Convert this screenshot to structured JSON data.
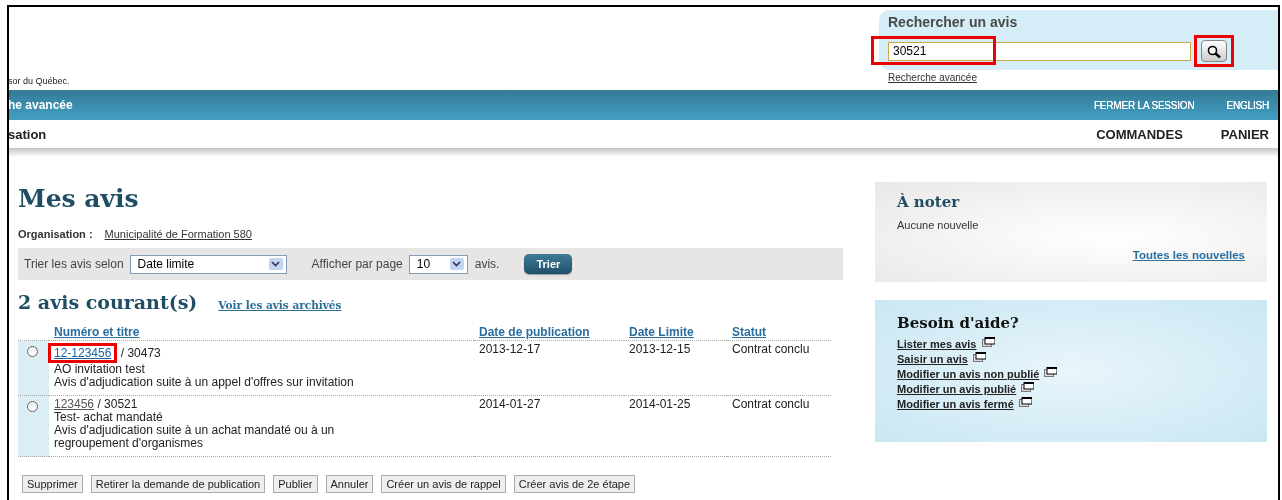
{
  "header": {
    "tagline": "sor du Québec.",
    "search": {
      "title": "Rechercher un avis",
      "value": "30521",
      "highlighted": true,
      "button_highlighted": true,
      "advanced_link": "Recherche avancée"
    },
    "top_bar": {
      "left": "he avancée",
      "links": [
        "FERMER LA SESSION",
        "ENGLISH"
      ]
    },
    "nav": {
      "left": "sation",
      "items": [
        "COMMANDES",
        "PANIER"
      ]
    }
  },
  "main": {
    "title": "Mes avis",
    "organisation_label": "Organisation :",
    "organisation": "Municipalité de Formation 580",
    "sort": {
      "label": "Trier les avis selon",
      "value": "Date limite",
      "per_page_label": "Afficher par page",
      "per_page": "10",
      "per_page_suffix": "avis.",
      "button": "Trier"
    },
    "count_title": "2 avis courant(s)",
    "archive_link": "Voir les avis archivés",
    "table": {
      "columns": [
        "Numéro et titre",
        "Date de publication",
        "Date Limite",
        "Statut"
      ],
      "rows": [
        {
          "selected": false,
          "highlighted": true,
          "visited": false,
          "number": "12-123456",
          "ref": "/ 30473",
          "title": "AO invitation test",
          "type": "Avis d'adjudication suite à un appel d'offres sur invitation",
          "published": "2013-12-17",
          "deadline": "2013-12-15",
          "status": "Contrat conclu"
        },
        {
          "selected": false,
          "highlighted": false,
          "visited": true,
          "number": "123456",
          "ref": "/ 30521",
          "title": "Test- achat mandaté",
          "type": "Avis d'adjudication suite à un achat mandaté ou à un regroupement d'organismes",
          "published": "2014-01-27",
          "deadline": "2014-01-25",
          "status": "Contrat conclu"
        }
      ]
    },
    "actions": [
      "Supprimer",
      "Retirer la demande de publication",
      "Publier",
      "Annuler",
      "Créer un avis de rappel",
      "Créer avis de 2e étape"
    ]
  },
  "sidebar": {
    "notes": {
      "title": "À noter",
      "text": "Aucune nouvelle",
      "link": "Toutes les nouvelles"
    },
    "help": {
      "title": "Besoin d'aide?",
      "links": [
        "Lister mes avis",
        "Saisir un avis",
        "Modifier un avis non publié",
        "Modifier un avis publié",
        "Modifier un avis fermé"
      ]
    }
  }
}
